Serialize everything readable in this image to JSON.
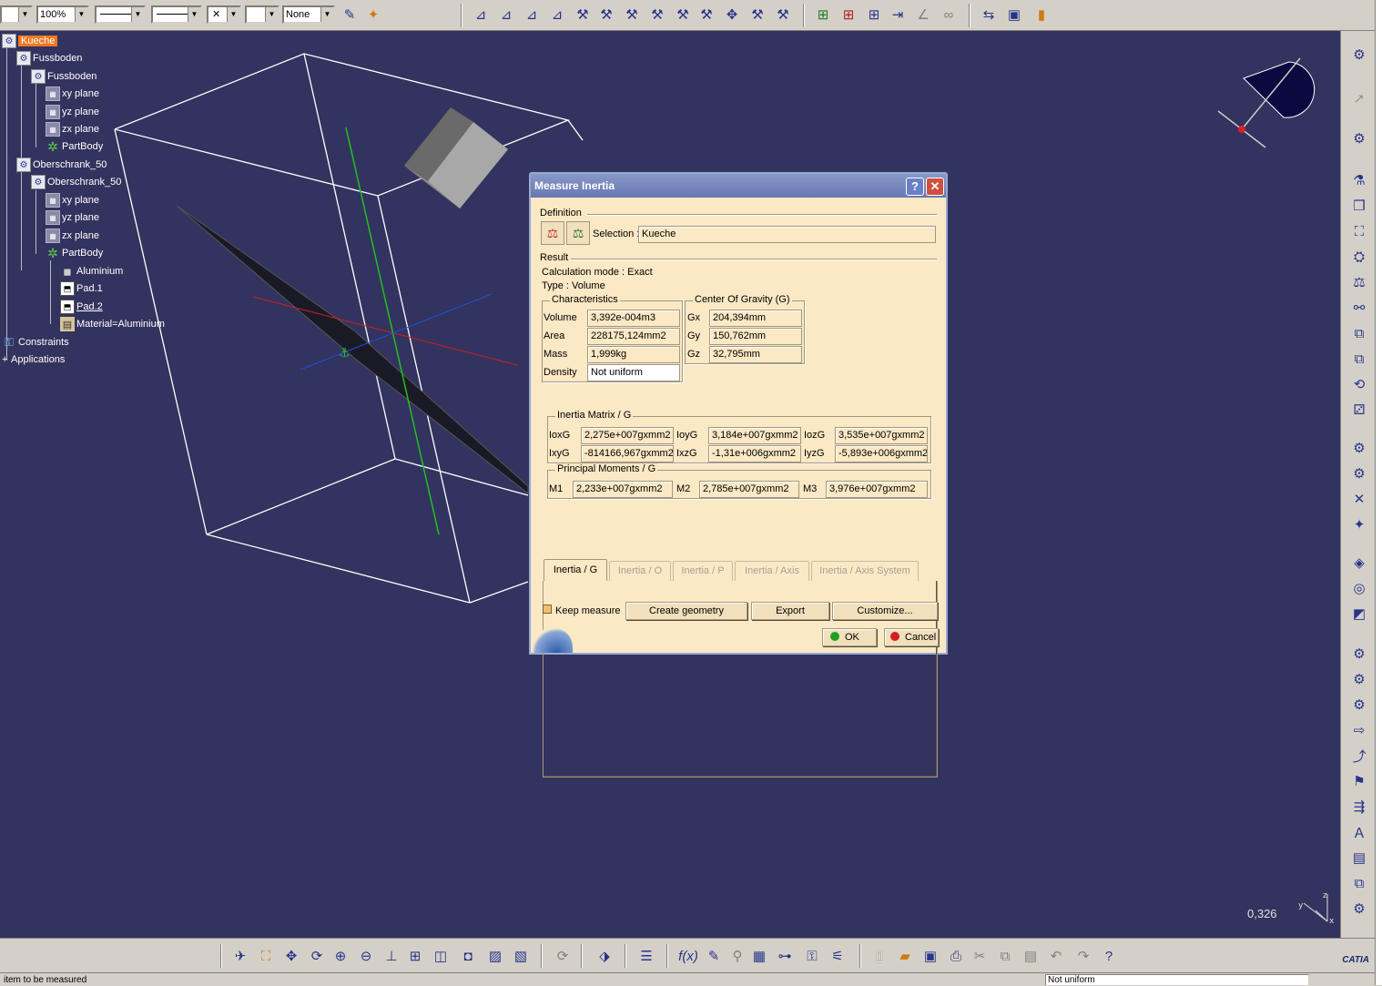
{
  "toolbar_top": {
    "zoom": "100%",
    "none_label": "None"
  },
  "tree": {
    "root": "Kueche",
    "items": [
      {
        "label": "Fussboden"
      },
      {
        "label": "Fussboden"
      },
      {
        "label": "xy plane"
      },
      {
        "label": "yz plane"
      },
      {
        "label": "zx plane"
      },
      {
        "label": "PartBody"
      },
      {
        "label": "Oberschrank_50"
      },
      {
        "label": "Oberschrank_50"
      },
      {
        "label": "xy plane"
      },
      {
        "label": "yz plane"
      },
      {
        "label": "zx plane"
      },
      {
        "label": "PartBody"
      },
      {
        "label": "Aluminium"
      },
      {
        "label": "Pad.1"
      },
      {
        "label": "Pad.2"
      },
      {
        "label": "Material=Aluminium"
      },
      {
        "label": "Constraints"
      },
      {
        "label": "Applications"
      }
    ]
  },
  "dialog": {
    "title": "Measure Inertia",
    "help": "?",
    "close": "✕",
    "definition_label": "Definition",
    "selection_label": "Selection :",
    "selection_value": "Kueche",
    "result_label": "Result",
    "calc_mode": "Calculation mode :  Exact",
    "type": "Type :  Volume",
    "characteristics": {
      "title": "Characteristics",
      "rows": [
        {
          "label": "Volume",
          "value": "3,392e-004m3"
        },
        {
          "label": "Area",
          "value": "228175,124mm2"
        },
        {
          "label": "Mass",
          "value": "1,999kg"
        },
        {
          "label": "Density",
          "value": "Not uniform"
        }
      ]
    },
    "cog": {
      "title": "Center Of Gravity (G)",
      "rows": [
        {
          "label": "Gx",
          "value": "204,394mm"
        },
        {
          "label": "Gy",
          "value": "150,762mm"
        },
        {
          "label": "Gz",
          "value": "32,795mm"
        }
      ]
    },
    "tabs": [
      "Inertia / G",
      "Inertia / O",
      "Inertia / P",
      "Inertia / Axis",
      "Inertia / Axis System"
    ],
    "matrix": {
      "title": "Inertia Matrix / G",
      "rows": [
        [
          {
            "label": "IoxG",
            "value": "2,275e+007gxmm2"
          },
          {
            "label": "IoyG",
            "value": "3,184e+007gxmm2"
          },
          {
            "label": "IozG",
            "value": "3,535e+007gxmm2"
          }
        ],
        [
          {
            "label": "IxyG",
            "value": "-814166,967gxmm2"
          },
          {
            "label": "IxzG",
            "value": "-1,31e+006gxmm2"
          },
          {
            "label": "IyzG",
            "value": "-5,893e+006gxmm2"
          }
        ]
      ]
    },
    "principal": {
      "title": "Principal Moments / G",
      "items": [
        {
          "label": "M1",
          "value": "2,233e+007gxmm2"
        },
        {
          "label": "M2",
          "value": "2,785e+007gxmm2"
        },
        {
          "label": "M3",
          "value": "3,976e+007gxmm2"
        }
      ]
    },
    "keep_measure": "Keep measure",
    "create_geometry": "Create geometry",
    "export": "Export",
    "customize": "Customize...",
    "ok": "OK",
    "cancel": "Cancel"
  },
  "viewport": {
    "scale_readout": "0,326"
  },
  "status": {
    "left": "item to be measured",
    "right": "Not uniform"
  },
  "colors": {
    "viewport_bg": "#33335f",
    "dialog_bg": "#fbe8c4",
    "title_bar": "#6878b4",
    "close_button": "#d05040"
  },
  "brand": "CATIA"
}
